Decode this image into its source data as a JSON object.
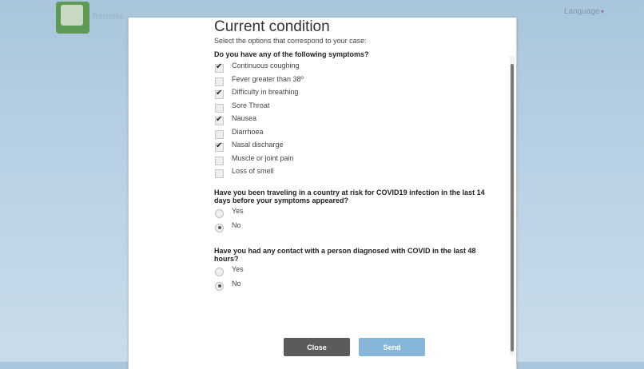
{
  "header": {
    "logo_text": "Remote",
    "language_label": "Language"
  },
  "modal": {
    "title": "Current condition",
    "subtitle": "Select the options that correspond to your case:",
    "symptoms_question": "Do you have any of the following symptoms?",
    "symptoms": [
      {
        "label": "Continuous coughing",
        "checked": true
      },
      {
        "label": "Fever greater than 38º",
        "checked": false
      },
      {
        "label": "Difficulty in breathing",
        "checked": true
      },
      {
        "label": "Sore Throat",
        "checked": false
      },
      {
        "label": "Nausea",
        "checked": true
      },
      {
        "label": "Diarrhoea",
        "checked": false
      },
      {
        "label": "Nasal discharge",
        "checked": true
      },
      {
        "label": "Muscle or joint pain",
        "checked": false
      },
      {
        "label": "Loss of smell",
        "checked": false
      }
    ],
    "travel_question": "Have you been traveling in a country at risk for COVID19 infection in the last 14 days before your symptoms appeared?",
    "travel_options": [
      {
        "label": "Yes",
        "selected": false
      },
      {
        "label": "No",
        "selected": true
      }
    ],
    "contact_question": "Have you had any contact with a person diagnosed with COVID in the last 48 hours?",
    "contact_options": [
      {
        "label": "Yes",
        "selected": false
      },
      {
        "label": "No",
        "selected": true
      }
    ],
    "close_label": "Close",
    "send_label": "Send"
  },
  "colors": {
    "close_bg": "#5b5b5b",
    "send_bg": "#86b6d9",
    "background": "#b5cfe2"
  }
}
